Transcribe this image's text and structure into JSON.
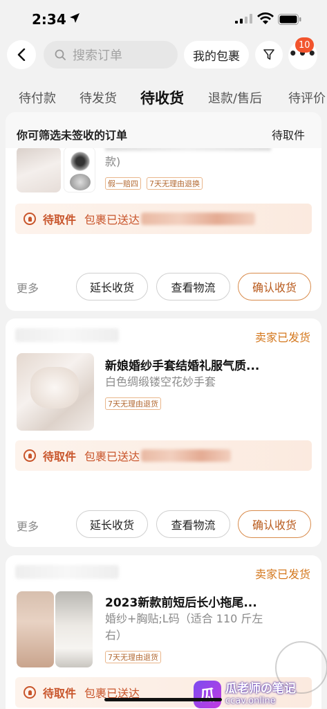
{
  "status_bar": {
    "time": "2:34"
  },
  "header": {
    "search_placeholder": "搜索订单",
    "package_label": "我的包裹",
    "badge_count": "10"
  },
  "tabs": [
    {
      "label": "待付款"
    },
    {
      "label": "待发货"
    },
    {
      "label": "待收货",
      "active": true
    },
    {
      "label": "退款/售后"
    },
    {
      "label": "待评价"
    }
  ],
  "filter_bar": {
    "left": "你可筛选未签收的订单",
    "right": "待取件"
  },
  "orders": [
    {
      "title_partial": "款)",
      "tags": [
        "假一赔四",
        "7天无理由退换"
      ],
      "pickup_label": "待取件",
      "pickup_text": "包裹已送达",
      "more": "更多",
      "actions": [
        "延长收货",
        "查看物流",
        "确认收货"
      ]
    },
    {
      "status": "卖家已发货",
      "title": "新娘婚纱手套结婚礼服气质...",
      "spec": "白色绸缎镂空花妙手套",
      "tags": [
        "7天无理由退货"
      ],
      "pickup_label": "待取件",
      "pickup_text": "包裹已送达",
      "more": "更多",
      "actions": [
        "延长收货",
        "查看物流",
        "确认收货"
      ]
    },
    {
      "status": "卖家已发货",
      "title": "2023新款前短后长小拖尾...",
      "spec": "婚纱+胸贴;L码（适合 110 斤左右）",
      "tags": [
        "7天无理由退货"
      ],
      "pickup_label": "待取件",
      "pickup_text": "包裹已送达"
    }
  ],
  "watermark": {
    "line1": "瓜老师の笔记",
    "line2": "ccav.online"
  },
  "colors": {
    "accent": "#c8542a",
    "seller_status": "#d4781e",
    "badge": "#f2542d"
  }
}
